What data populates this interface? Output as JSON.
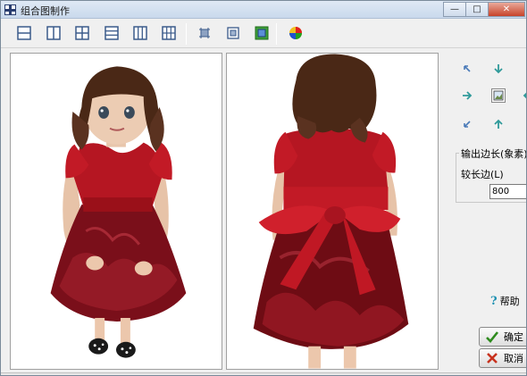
{
  "window": {
    "title": "组合图制作",
    "minimize_glyph": "—",
    "maximize_glyph": "□",
    "close_glyph": "✕"
  },
  "toolbar": {
    "tools": [
      {
        "name": "layout-2-rows-icon"
      },
      {
        "name": "layout-2-cols-icon"
      },
      {
        "name": "layout-4-grid-icon"
      },
      {
        "name": "layout-3-rows-icon"
      },
      {
        "name": "layout-3-cols-icon"
      },
      {
        "name": "layout-6-grid-icon"
      },
      {
        "name": "crop-icon"
      },
      {
        "name": "fit-frame-icon"
      },
      {
        "name": "select-frame-icon"
      },
      {
        "name": "color-icon"
      }
    ]
  },
  "settings": {
    "group_title": "输出边长(象素)",
    "long_edge_label": "较长边(L)",
    "long_edge_value": "800"
  },
  "help_label": "帮助",
  "ok_label": "确定",
  "cancel_label": "取消",
  "colors": {
    "dress": "#b0141e",
    "dress_dark": "#6e0c14",
    "hair": "#4a2a18",
    "skin": "#eccbb2",
    "accent_ok": "#2e8b1e",
    "accent_cancel": "#c8321e"
  }
}
